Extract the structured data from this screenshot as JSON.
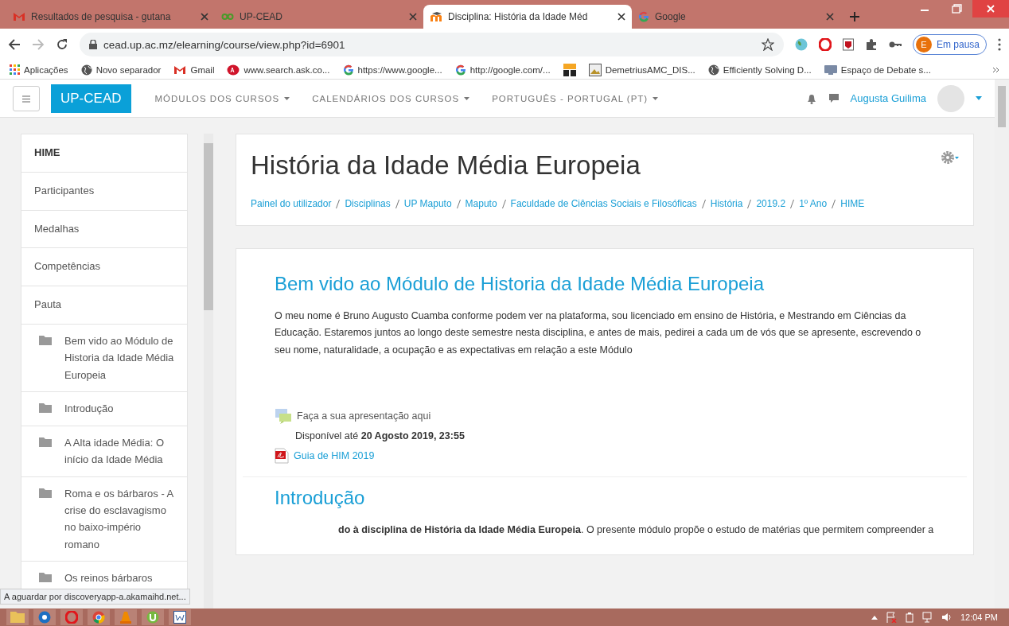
{
  "browser": {
    "tabs": [
      {
        "title": "Resultados de pesquisa - gutana",
        "selected": false
      },
      {
        "title": "UP-CEAD",
        "selected": false
      },
      {
        "title": "Disciplina: História da Idade Méd",
        "selected": true
      },
      {
        "title": "Google",
        "selected": false
      }
    ],
    "url": "cead.up.ac.mz/elearning/course/view.php?id=6901",
    "bookmarks": [
      {
        "label": "Aplicações"
      },
      {
        "label": "Novo separador"
      },
      {
        "label": "Gmail"
      },
      {
        "label": "www.search.ask.co..."
      },
      {
        "label": "https://www.google..."
      },
      {
        "label": "http://google.com/..."
      },
      {
        "label": "DemetriusAMC_DIS..."
      },
      {
        "label": "Efficiently Solving D..."
      },
      {
        "label": "Espaço de Debate s..."
      }
    ],
    "profile": {
      "initial": "E",
      "label": "Em pausa"
    }
  },
  "navbar": {
    "brand": "UP-CEAD",
    "menus": [
      "MÓDULOS DOS CURSOS",
      "CALENDÁRIOS DOS CURSOS",
      "PORTUGUÊS - PORTUGAL (PT)"
    ],
    "user": "Augusta Guilima"
  },
  "sidebar": {
    "items": [
      {
        "label": "HIME",
        "kind": "header"
      },
      {
        "label": "Participantes",
        "kind": "link"
      },
      {
        "label": "Medalhas",
        "kind": "link"
      },
      {
        "label": "Competências",
        "kind": "link"
      },
      {
        "label": "Pauta",
        "kind": "link"
      },
      {
        "label": "Bem vido ao Módulo de Historia da Idade Média Europeia",
        "kind": "section"
      },
      {
        "label": "Introdução",
        "kind": "section"
      },
      {
        "label": "A Alta idade Média: O início da Idade Média",
        "kind": "section"
      },
      {
        "label": "Roma e os bárbaros - A crise do esclavagismo no baixo-império romano",
        "kind": "section"
      },
      {
        "label": "Os reinos bárbaros",
        "kind": "section"
      }
    ]
  },
  "course": {
    "title": "História da Idade Média Europeia",
    "breadcrumb": [
      "Painel do utilizador",
      "Disciplinas",
      "UP Maputo",
      "Maputo",
      "Faculdade de Ciências Sociais e Filosóficas",
      "História",
      "2019.2",
      "1º Ano",
      "HIME"
    ],
    "sections": [
      {
        "title": "Bem vido ao Módulo de Historia da Idade Média Europeia",
        "text": "O meu nome é Bruno Augusto Cuamba conforme podem ver na plataforma,  sou licenciado em ensino de  História, e Mestrando em Ciências da Educação. Estaremos juntos ao longo deste semestre nesta disciplina, e antes de mais, pedirei a cada um de vós que se apresente, escrevendo o seu nome, naturalidade, a ocupação e as expectativas em relação a este Módulo",
        "activities": [
          {
            "kind": "forum",
            "label": "Faça a sua apresentação aqui",
            "availability": "Disponível até **20 Agosto 2019, 23:55**"
          },
          {
            "kind": "pdf",
            "label": "Guia de HIM 2019"
          }
        ]
      },
      {
        "title": "Introdução",
        "text": "**do à disciplina de História da Idade Média Europeia**. O presente módulo propõe o estudo de matérias que permitem compreender a"
      }
    ]
  },
  "status_text": "A aguardar por discoveryapp-a.akamaihd.net...",
  "taskbar": {
    "time": "12:04 PM"
  }
}
